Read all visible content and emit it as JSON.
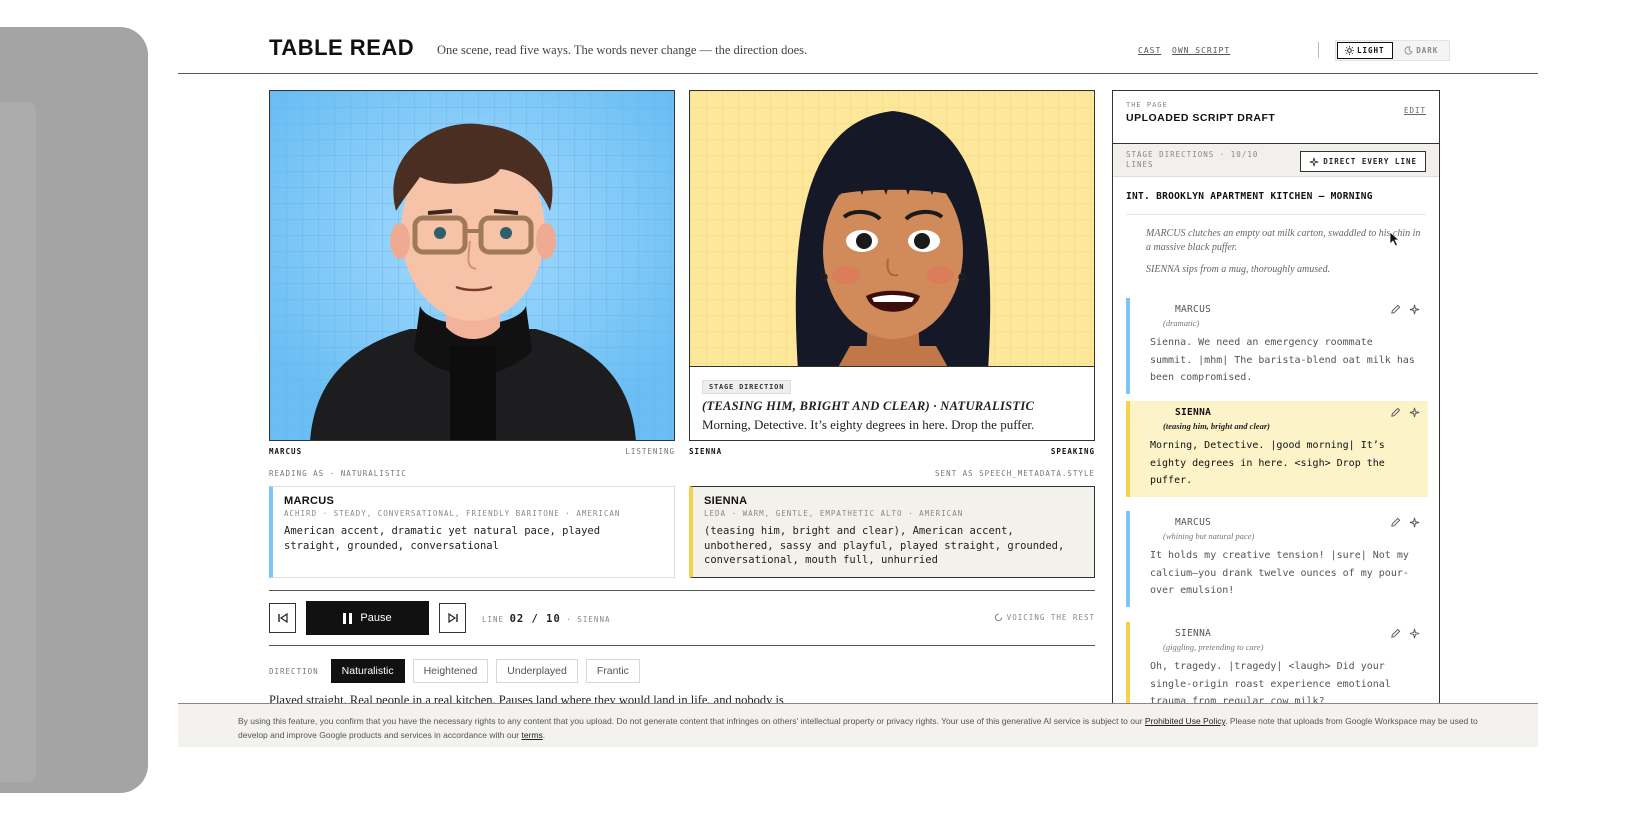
{
  "header": {
    "title": "TABLE READ",
    "tagline": "One scene, read five ways. The words never change — the direction does.",
    "links": [
      "CAST",
      "OWN SCRIPT"
    ],
    "theme": {
      "light": "LIGHT",
      "dark": "DARK",
      "selected": "LIGHT"
    }
  },
  "colors": {
    "marcus_accent": "#7cc6f6",
    "sienna_accent": "#f4d24b",
    "ink": "#111111"
  },
  "stage": {
    "tag": "STAGE DIRECTION",
    "direction": "(TEASING HIM, BRIGHT AND CLEAR) · NATURALISTIC",
    "line": "Morning, Detective. It’s eighty degrees in here. Drop the puffer."
  },
  "cast": {
    "marcus": {
      "label": "MARCUS",
      "status": "LISTENING"
    },
    "sienna": {
      "label": "SIENNA",
      "status": "SPEAKING"
    }
  },
  "reading_as": "READING AS · NATURALISTIC",
  "sent_as": "SENT AS SPEECH_METADATA.STYLE",
  "voice_cards": [
    {
      "name": "MARCUS",
      "meta": "ACHIRD · STEADY, CONVERSATIONAL, FRIENDLY BARITONE · AMERICAN",
      "prompt": "American accent, dramatic yet natural pace, played straight, grounded, conversational"
    },
    {
      "name": "SIENNA",
      "meta": "LEDA · WARM, GENTLE, EMPATHETIC ALTO · AMERICAN",
      "prompt": "(teasing him, bright and clear), American accent, unbothered, sassy and playful, played straight, grounded, conversational, mouth full, unhurried"
    }
  ],
  "transport": {
    "pause_label": "Pause",
    "line_prefix": "LINE",
    "line_current": "02 / 10",
    "line_speaker": "· SIENNA",
    "voicing": "VOICING THE REST"
  },
  "direction": {
    "label": "DIRECTION",
    "options": [
      "Naturalistic",
      "Heightened",
      "Underplayed",
      "Frantic"
    ],
    "selected": "Naturalistic",
    "description": "Played straight. Real people in a real kitchen. Pauses land where they would land in life, and nobody is performing for the room."
  },
  "script": {
    "kicker": "THE PAGE",
    "title": "UPLOADED SCRIPT DRAFT",
    "edit": "EDIT",
    "count": "STAGE DIRECTIONS · 10/10 LINES",
    "direct_button": "DIRECT EVERY LINE",
    "scene": "INT. BROOKLYN APARTMENT KITCHEN – MORNING",
    "actions": [
      "MARCUS clutches an empty oat milk carton, swaddled to his chin in a massive black puffer.",
      "SIENNA sips from a mug, thoroughly amused."
    ],
    "lines": [
      {
        "character": "MARCUS",
        "paren": "(dramatic)",
        "dialog": "Sienna. We need an emergency roommate summit. |mhm| The barista-blend oat milk has been compromised."
      },
      {
        "character": "SIENNA",
        "paren": "(teasing him, bright and clear)",
        "dialog": "Morning, Detective. |good morning| It’s eighty degrees in here. <sigh> Drop the puffer."
      },
      {
        "character": "MARCUS",
        "paren": "(whining but natural pace)",
        "dialog": "It holds my creative tension! |sure| Not my calcium—you drank twelve ounces of my pour-over emulsion!"
      },
      {
        "character": "SIENNA",
        "paren": "(giggling, pretending to care)",
        "dialog": "Oh, tragedy. |tragedy| <laugh> Did your single-origin roast experience emotional trauma from regular cow milk?"
      }
    ]
  },
  "footer": {
    "text_a": "By using this feature, you confirm that you have the necessary rights to any content that you upload. Do not generate content that infringes on others' intellectual property or privacy rights. Your use of this generative AI service is subject to our ",
    "link_a": "Prohibited Use Policy",
    "text_b": ". Please note that uploads from Google Workspace may be used to develop and improve Google products and services in accordance with our ",
    "link_b": "terms",
    "text_c": "."
  }
}
